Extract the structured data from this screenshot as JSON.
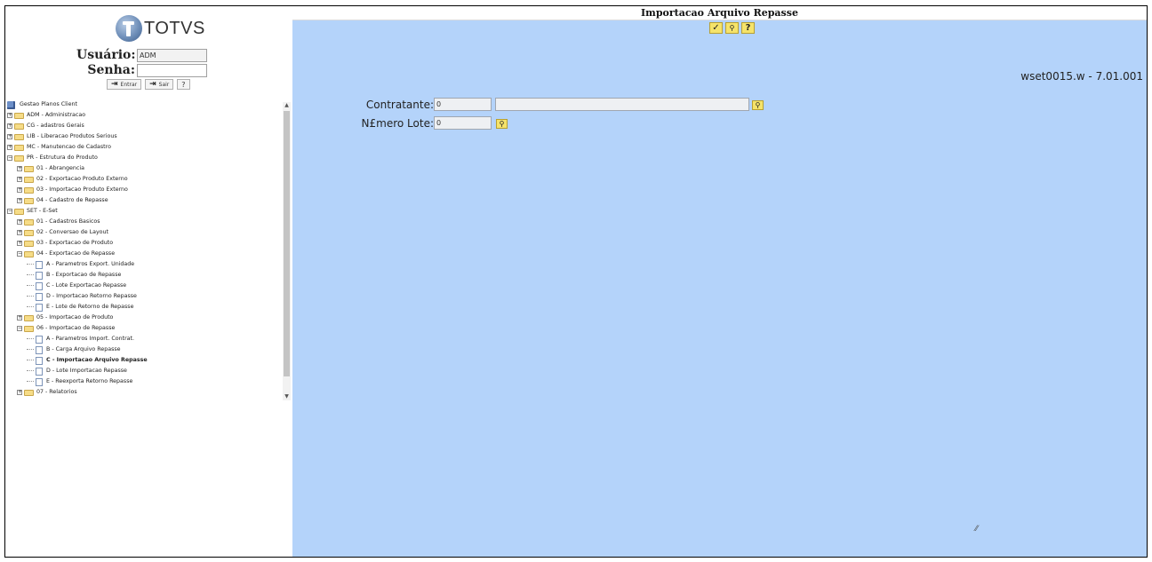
{
  "login": {
    "logo_text": "TOTVS",
    "user_label": "Usuário:",
    "user_value": "ADM",
    "password_label": "Senha:",
    "enter_label": "Entrar",
    "exit_label": "Sair",
    "help_label": "?"
  },
  "tree": {
    "root": "Gestao Planos Client",
    "items": [
      {
        "label": "ADM - Administracao",
        "level": 0,
        "kind": "folder",
        "expanded": false
      },
      {
        "label": "CG - adastros Gerais",
        "level": 0,
        "kind": "folder",
        "expanded": false
      },
      {
        "label": "LIB - Liberacao Produtos Serious",
        "level": 0,
        "kind": "folder",
        "expanded": false
      },
      {
        "label": "MC - Manutencao de Cadastro",
        "level": 0,
        "kind": "folder",
        "expanded": false
      },
      {
        "label": "PR - Estrutura do Produto",
        "level": 0,
        "kind": "folder",
        "expanded": true
      },
      {
        "label": "01 - Abrangencia",
        "level": 1,
        "kind": "folder",
        "expanded": false
      },
      {
        "label": "02 - Exportacao Produto Externo",
        "level": 1,
        "kind": "folder",
        "expanded": false
      },
      {
        "label": "03 - Importacao Produto Externo",
        "level": 1,
        "kind": "folder",
        "expanded": false
      },
      {
        "label": "04 - Cadastro de Repasse",
        "level": 1,
        "kind": "folder",
        "expanded": false
      },
      {
        "label": "SET - E-Set",
        "level": 0,
        "kind": "folder",
        "expanded": true
      },
      {
        "label": "01 - Cadastros Basicos",
        "level": 1,
        "kind": "folder",
        "expanded": false
      },
      {
        "label": "02 - Conversao de Layout",
        "level": 1,
        "kind": "folder",
        "expanded": false
      },
      {
        "label": "03 - Exportacao de Produto",
        "level": 1,
        "kind": "folder",
        "expanded": false
      },
      {
        "label": "04 - Exportacao de Repasse",
        "level": 1,
        "kind": "folder",
        "expanded": true
      },
      {
        "label": "A - Parametros Export. Unidade",
        "level": 2,
        "kind": "doc"
      },
      {
        "label": "B - Exportacao de Repasse",
        "level": 2,
        "kind": "doc"
      },
      {
        "label": "C - Lote Exportacao Repasse",
        "level": 2,
        "kind": "doc"
      },
      {
        "label": "D - Importacao Retorno Repasse",
        "level": 2,
        "kind": "doc"
      },
      {
        "label": "E - Lote de Retorno de Repasse",
        "level": 2,
        "kind": "doc"
      },
      {
        "label": "05 - Importacao de Produto",
        "level": 1,
        "kind": "folder",
        "expanded": false
      },
      {
        "label": "06 - Importacao de Repasse",
        "level": 1,
        "kind": "folder",
        "expanded": true
      },
      {
        "label": "A - Parametros Import. Contrat.",
        "level": 2,
        "kind": "doc"
      },
      {
        "label": "B - Carga Arquivo Repasse",
        "level": 2,
        "kind": "doc"
      },
      {
        "label": "C - Importacao Arquivo Repasse",
        "level": 2,
        "kind": "doc",
        "selected": true
      },
      {
        "label": "D - Lote Importacao Repasse",
        "level": 2,
        "kind": "doc"
      },
      {
        "label": "E - Reexporta Retorno Repasse",
        "level": 2,
        "kind": "doc"
      },
      {
        "label": "07 - Relatorios",
        "level": 1,
        "kind": "folder",
        "expanded": false
      }
    ]
  },
  "main": {
    "title": "Importacao Arquivo Repasse",
    "toolbar": {
      "confirm_icon": "✓",
      "search_icon": "🔍",
      "help_label": "?"
    },
    "version": "wset0015.w - 7.01.001",
    "contratante_label": "Contratante:",
    "contratante_value": "0",
    "contratante_desc": "",
    "lote_label": "N£mero Lote:",
    "lote_value": "0"
  },
  "colors": {
    "background": "#b4d3fa",
    "button": "#f5e36a"
  }
}
